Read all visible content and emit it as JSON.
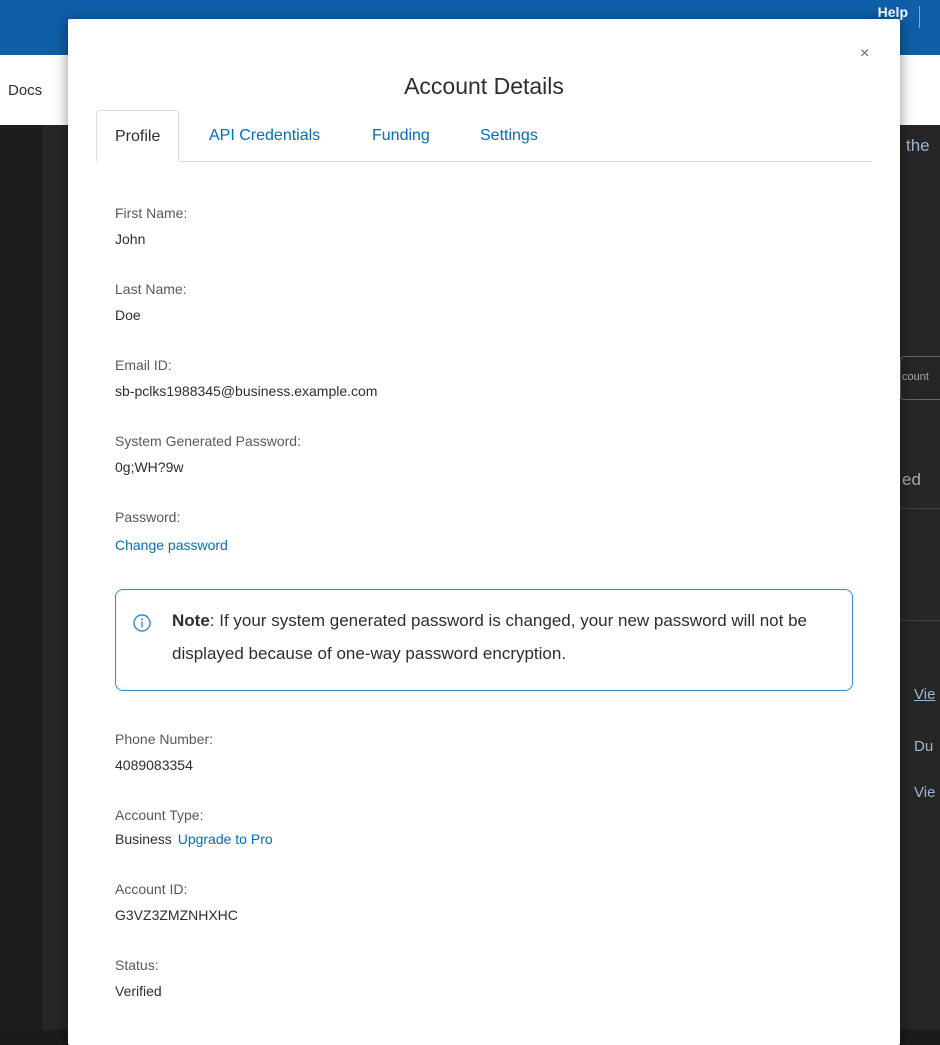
{
  "background": {
    "help_label": "Help",
    "docs_label": "Docs",
    "peek_texts": [
      "the",
      "count",
      "ed",
      "Vie",
      "Du",
      "Vie"
    ]
  },
  "modal": {
    "title": "Account Details",
    "close_glyph": "×",
    "tabs": [
      {
        "label": "Profile",
        "active": true
      },
      {
        "label": "API Credentials",
        "active": false
      },
      {
        "label": "Funding",
        "active": false
      },
      {
        "label": "Settings",
        "active": false
      }
    ]
  },
  "profile": {
    "first_name": {
      "label": "First Name:",
      "value": "John"
    },
    "last_name": {
      "label": "Last Name:",
      "value": "Doe"
    },
    "email": {
      "label": "Email ID:",
      "value": "sb-pclks1988345@business.example.com"
    },
    "system_password": {
      "label": "System Generated Password:",
      "value": "0g;WH?9w"
    },
    "password": {
      "label": "Password:",
      "link": "Change password"
    },
    "note": {
      "icon": "info-icon",
      "strong": "Note",
      "text": ": If your system generated password is changed, your new password will not be displayed because of one-way password encryption."
    },
    "phone": {
      "label": "Phone Number:",
      "value": "4089083354"
    },
    "account_type": {
      "label": "Account Type:",
      "value": "Business",
      "link": "Upgrade to Pro"
    },
    "account_id": {
      "label": "Account ID:",
      "value": "G3VZ3ZMZNHXHC"
    },
    "status": {
      "label": "Status:",
      "value": "Verified"
    }
  },
  "colors": {
    "brand_blue": "#0e5fa7",
    "link_blue": "#0070ba",
    "note_border": "#2d8ed4",
    "text_dark": "#2c2e2f",
    "label_gray": "#555a5d"
  }
}
